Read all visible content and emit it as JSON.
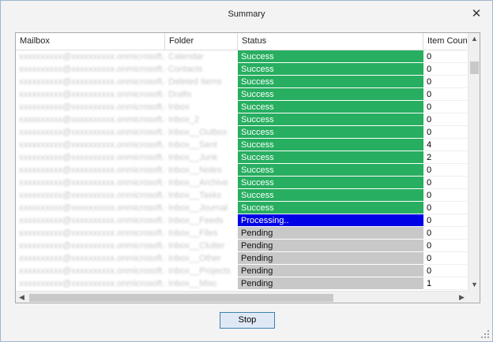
{
  "window": {
    "title": "Summary",
    "close_icon": "close-icon"
  },
  "grid": {
    "columns": [
      "Mailbox",
      "Folder",
      "Status",
      "Item Count"
    ],
    "rows": [
      {
        "mailbox": "xxxxxxxxxx@xxxxxxxxxx.onmicrosoft.com",
        "folder": "Calendar",
        "status": "Success",
        "count": "0"
      },
      {
        "mailbox": "xxxxxxxxxx@xxxxxxxxxx.onmicrosoft.com",
        "folder": "Contacts",
        "status": "Success",
        "count": "0"
      },
      {
        "mailbox": "xxxxxxxxxx@xxxxxxxxxx.onmicrosoft.com",
        "folder": "Deleted Items",
        "status": "Success",
        "count": "0"
      },
      {
        "mailbox": "xxxxxxxxxx@xxxxxxxxxx.onmicrosoft.com",
        "folder": "Drafts",
        "status": "Success",
        "count": "0"
      },
      {
        "mailbox": "xxxxxxxxxx@xxxxxxxxxx.onmicrosoft.com",
        "folder": "Inbox",
        "status": "Success",
        "count": "0"
      },
      {
        "mailbox": "xxxxxxxxxx@xxxxxxxxxx.onmicrosoft.com",
        "folder": "Inbox_2",
        "status": "Success",
        "count": "0"
      },
      {
        "mailbox": "xxxxxxxxxx@xxxxxxxxxx.onmicrosoft.com",
        "folder": "Inbox__Outbox",
        "status": "Success",
        "count": "0"
      },
      {
        "mailbox": "xxxxxxxxxx@xxxxxxxxxx.onmicrosoft.com",
        "folder": "Inbox__Sent",
        "status": "Success",
        "count": "4"
      },
      {
        "mailbox": "xxxxxxxxxx@xxxxxxxxxx.onmicrosoft.com",
        "folder": "Inbox__Junk",
        "status": "Success",
        "count": "2"
      },
      {
        "mailbox": "xxxxxxxxxx@xxxxxxxxxx.onmicrosoft.com",
        "folder": "Inbox__Notes",
        "status": "Success",
        "count": "0"
      },
      {
        "mailbox": "xxxxxxxxxx@xxxxxxxxxx.onmicrosoft.com",
        "folder": "Inbox__Archive",
        "status": "Success",
        "count": "0"
      },
      {
        "mailbox": "xxxxxxxxxx@xxxxxxxxxx.onmicrosoft.com",
        "folder": "Inbox__Tasks",
        "status": "Success",
        "count": "0"
      },
      {
        "mailbox": "xxxxxxxxxx@xxxxxxxxxx.onmicrosoft.com",
        "folder": "Inbox__Journal",
        "status": "Success",
        "count": "0"
      },
      {
        "mailbox": "xxxxxxxxxx@xxxxxxxxxx.onmicrosoft.com",
        "folder": "Inbox__Feeds",
        "status": "Processing..",
        "count": "0"
      },
      {
        "mailbox": "xxxxxxxxxx@xxxxxxxxxx.onmicrosoft.com",
        "folder": "Inbox__Files",
        "status": "Pending",
        "count": "0"
      },
      {
        "mailbox": "xxxxxxxxxx@xxxxxxxxxx.onmicrosoft.com",
        "folder": "Inbox__Clutter",
        "status": "Pending",
        "count": "0"
      },
      {
        "mailbox": "xxxxxxxxxx@xxxxxxxxxx.onmicrosoft.com",
        "folder": "Inbox__Other",
        "status": "Pending",
        "count": "0"
      },
      {
        "mailbox": "xxxxxxxxxx@xxxxxxxxxx.onmicrosoft.com",
        "folder": "Inbox__Projects",
        "status": "Pending",
        "count": "0"
      },
      {
        "mailbox": "xxxxxxxxxx@xxxxxxxxxx.onmicrosoft.com",
        "folder": "Inbox__Misc",
        "status": "Pending",
        "count": "1"
      }
    ]
  },
  "scrollbars": {
    "up": "▲",
    "down": "▼",
    "left": "◀",
    "right": "▶"
  },
  "actions": {
    "stop_label": "Stop"
  },
  "colors": {
    "success": "#27ae60",
    "processing": "#0000e6",
    "pending": "#c8c8c8"
  }
}
